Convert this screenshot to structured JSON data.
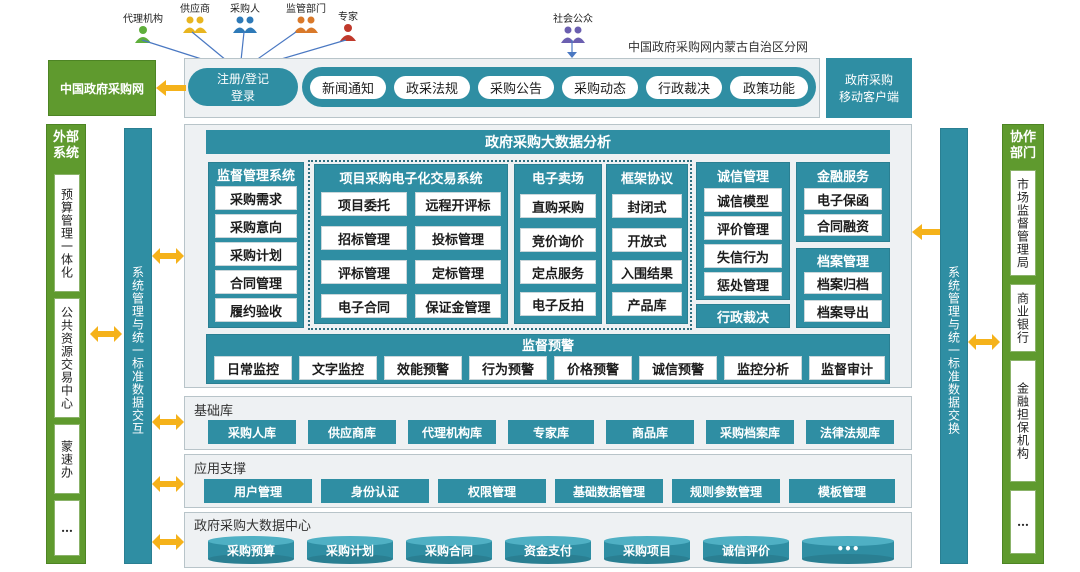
{
  "top_users": [
    "代理机构",
    "供应商",
    "采购人",
    "监管部门",
    "专家"
  ],
  "public_user": "社会公众",
  "portal_title": "中国政府采购网内蒙古自治区分网",
  "login": "注册/登记\n登录",
  "top_tabs": [
    "新闻通知",
    "政采法规",
    "采购公告",
    "采购动态",
    "行政裁决",
    "政策功能"
  ],
  "mobile_client": "政府采购\n移动客户端",
  "ccgp": "中国政府采购网",
  "external_title": "外部\n系统",
  "external_items": [
    "预算管理一体化",
    "公共资源交易中心",
    "蒙速办",
    "…"
  ],
  "left_bar": "系统管理与统一标准数据交互",
  "right_bar": "系统管理与统一标准数据交换",
  "partner_title": "协作\n部门",
  "partner_items": [
    "市场监督管理局",
    "商业银行",
    "金融担保机构",
    "…"
  ],
  "bigdata_title": "政府采购大数据分析",
  "supervision_mgmt": {
    "title": "监督管理系统",
    "items": [
      "采购需求",
      "采购意向",
      "采购计划",
      "合同管理",
      "履约验收"
    ]
  },
  "etrade": {
    "title": "项目采购电子化交易系统",
    "items": [
      "项目委托",
      "远程开评标",
      "招标管理",
      "投标管理",
      "评标管理",
      "定标管理",
      "电子合同",
      "保证金管理"
    ]
  },
  "emall": {
    "title": "电子卖场",
    "items": [
      "直购采购",
      "竞价询价",
      "定点服务",
      "电子反拍"
    ]
  },
  "framework": {
    "title": "框架协议",
    "items": [
      "封闭式",
      "开放式",
      "入围结果",
      "产品库"
    ]
  },
  "credit": {
    "title": "诚信管理",
    "items": [
      "诚信模型",
      "评价管理",
      "失信行为",
      "惩处管理"
    ]
  },
  "admin_ruling": "行政裁决",
  "finance": {
    "title": "金融服务",
    "items": [
      "电子保函",
      "合同融资"
    ]
  },
  "archive": {
    "title": "档案管理",
    "items": [
      "档案归档",
      "档案导出"
    ]
  },
  "warning": {
    "title": "监督预警",
    "items": [
      "日常监控",
      "文字监控",
      "效能预警",
      "行为预警",
      "价格预警",
      "诚信预警",
      "监控分析",
      "监督审计"
    ]
  },
  "base_lib": {
    "title": "基础库",
    "items": [
      "采购人库",
      "供应商库",
      "代理机构库",
      "专家库",
      "商品库",
      "采购档案库",
      "法律法规库"
    ]
  },
  "app_support": {
    "title": "应用支撑",
    "items": [
      "用户管理",
      "身份认证",
      "权限管理",
      "基础数据管理",
      "规则参数管理",
      "模板管理"
    ]
  },
  "data_center": {
    "title": "政府采购大数据中心",
    "items": [
      "采购预算",
      "采购计划",
      "采购合同",
      "资金支付",
      "采购项目",
      "诚信评价",
      "•••"
    ]
  },
  "colors": {
    "teal": "#2f8ea3",
    "green": "#5f9a2e",
    "arrow": "#f5b21a",
    "line": "#4a78c2"
  }
}
